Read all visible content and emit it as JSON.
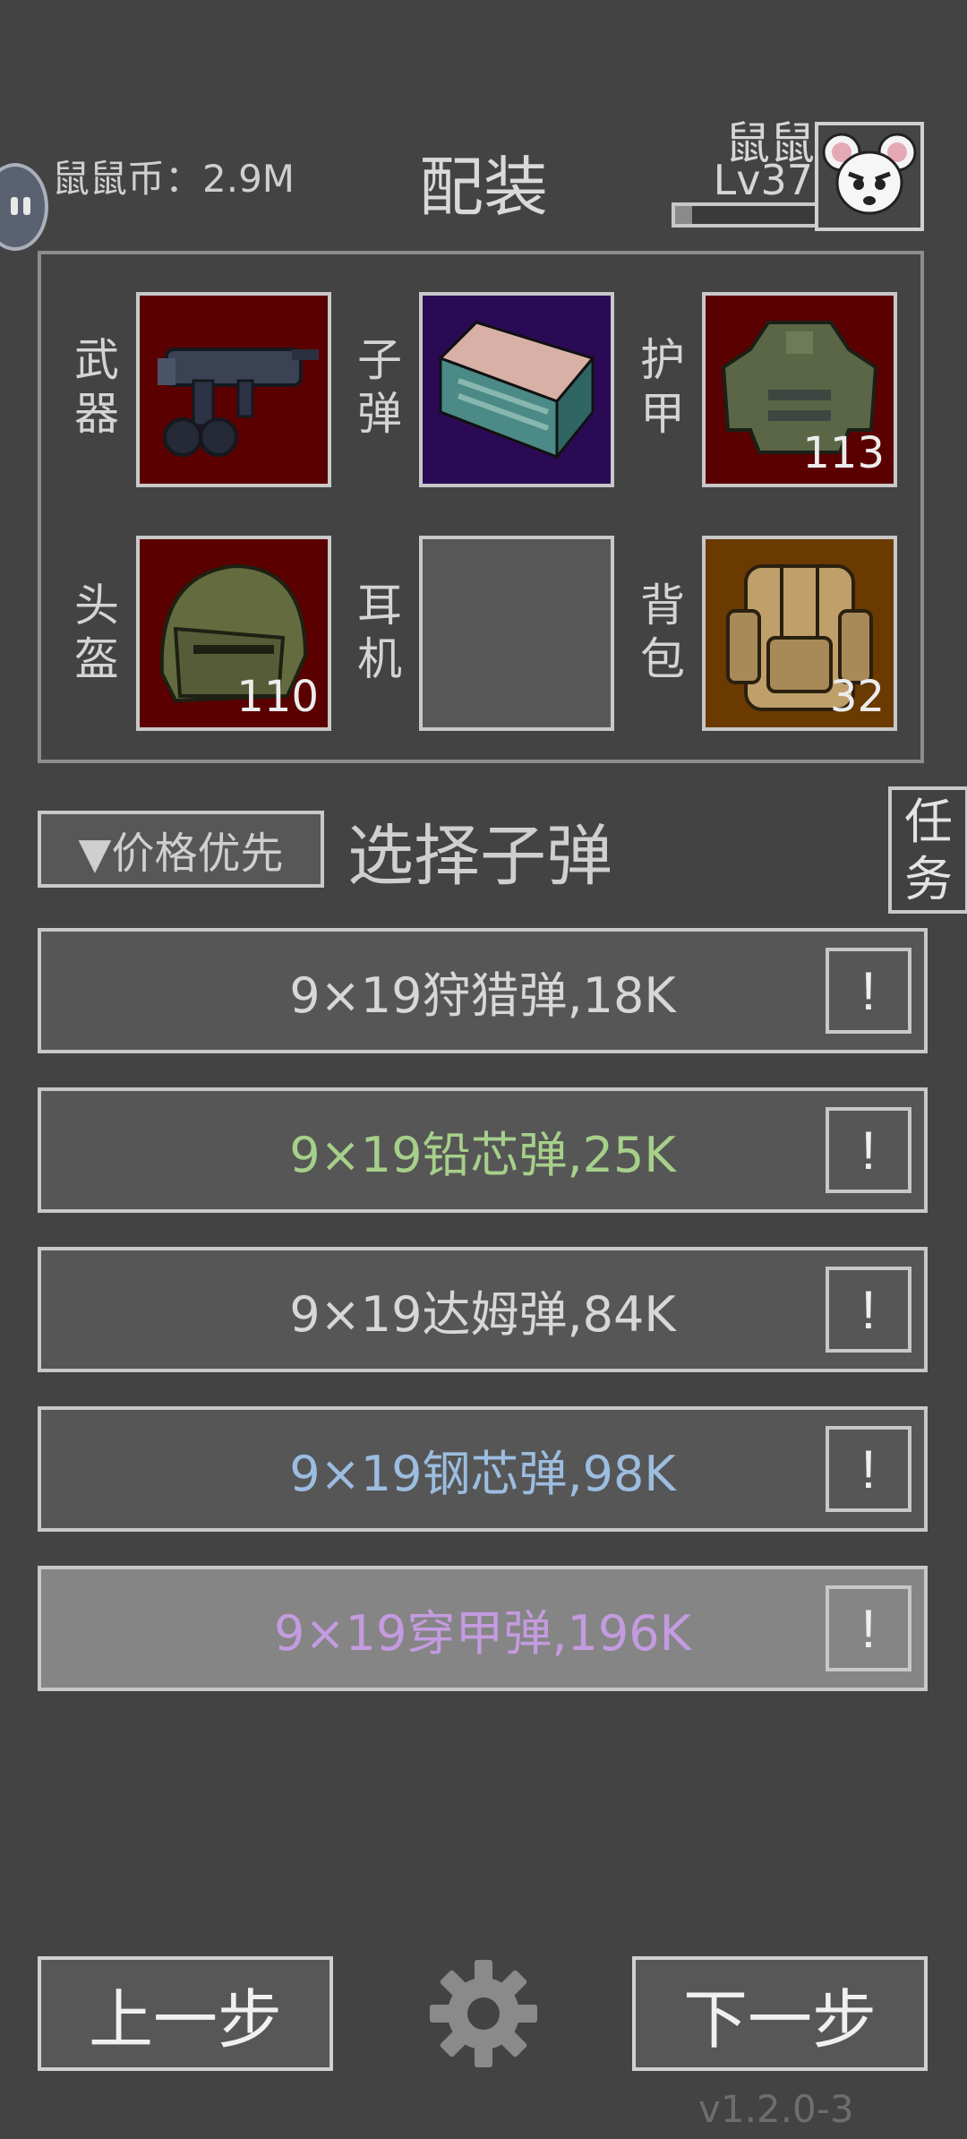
{
  "header": {
    "coins_text": "鼠鼠币：2.9M",
    "title": "配装",
    "player_name": "鼠鼠",
    "player_level": "Lv37",
    "xp_progress": 0.12
  },
  "equipment": [
    {
      "label": "武器",
      "count": "",
      "bg": "#5a0000"
    },
    {
      "label": "子弹",
      "count": "",
      "bg": "#2b0a55"
    },
    {
      "label": "护甲",
      "count": "113",
      "bg": "#5a0000"
    },
    {
      "label": "头盔",
      "count": "110",
      "bg": "#5a0000"
    },
    {
      "label": "耳机",
      "count": "",
      "bg": "#575757"
    },
    {
      "label": "背包",
      "count": "32",
      "bg": "#6a3a00"
    }
  ],
  "controls": {
    "sort_label": "▼价格优先",
    "select_title": "选择子弹",
    "task_label": "任务"
  },
  "ammo_list": [
    {
      "text": "9×19狩猎弹,18K",
      "color": "#d7d7d7",
      "info": "!"
    },
    {
      "text": "9×19铅芯弹,25K",
      "color": "#a6d08a",
      "info": "!"
    },
    {
      "text": "9×19达姆弹,84K",
      "color": "#d7d7d7",
      "info": "!"
    },
    {
      "text": "9×19钢芯弹,98K",
      "color": "#9cbde0",
      "info": "!"
    },
    {
      "text": "9×19穿甲弹,196K",
      "color": "#c49be0",
      "info": "!"
    }
  ],
  "footer": {
    "prev_label": "上一步",
    "next_label": "下一步",
    "version": "v1.2.0-3"
  }
}
